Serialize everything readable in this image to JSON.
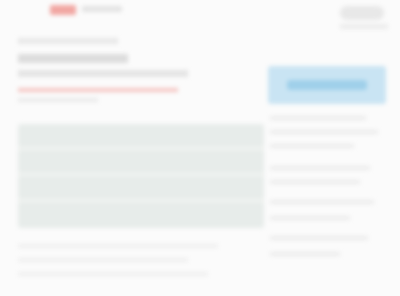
{
  "note": "",
  "colors": {
    "accent": "#f1a7a3",
    "banner": "#c9e4f3",
    "content_block": "#e7ecea"
  }
}
